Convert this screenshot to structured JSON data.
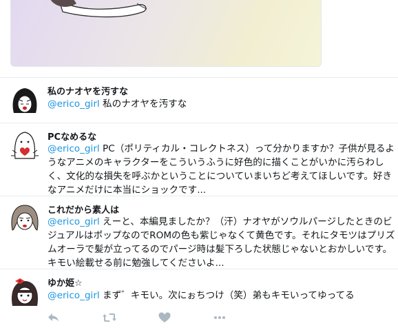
{
  "tweets": [
    {
      "name": "私のナオヤを汚すな",
      "mention": "@erico_girl",
      "text": " 私のナオヤを汚すな"
    },
    {
      "name": "PCなめるな",
      "mention": "@erico_girl",
      "text": " PC（ポリティカル・コレクトネス）って分かりますか？子供が見るようなアニメのキャラクターをこういうふうに好色的に描くことがいかに汚らわしく、文化的な損失を呼ぶかということについていまいちど考えてほしいです。好きなアニメだけに本当にショックです..."
    },
    {
      "name": "これだから素人は",
      "mention": "@erico_girl",
      "text": " えーと、本編見ましたか？（汗）ナオヤがソウルパージしたときのビジュアルはポップなのでROMの色も紫じゃなくて黄色です。それにタモツはプリズムオーラで髪が立ってるのでパージ時は髪下ろした状態じゃないとおかしいです。キモい絵載せる前に勉強してくださいよ..."
    },
    {
      "name": "ゆか姫☆",
      "mention": "@erico_girl",
      "text": " まず゛キモい。次にぉちつけ（笑）弟もキモいってゆってる"
    }
  ],
  "actions": {
    "reply_icon": "reply-icon",
    "retweet_icon": "retweet-icon",
    "like_icon": "heart-icon",
    "more_icon": "more-icon"
  },
  "colors": {
    "mention": "#1b95e0",
    "divider": "#e6ecf0",
    "action_icon": "#aab8c2"
  }
}
